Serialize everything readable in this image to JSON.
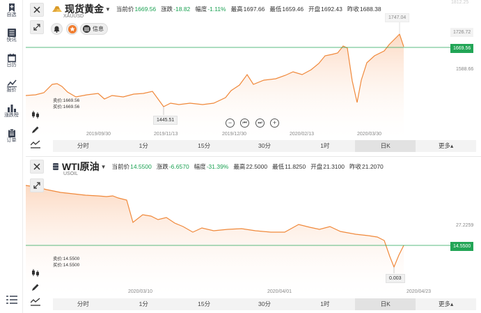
{
  "sidebar": {
    "items": [
      {
        "icon": "bookmark-plus-icon",
        "label": "自选"
      },
      {
        "icon": "news-list-icon",
        "label": "快讯"
      },
      {
        "icon": "calendar-icon",
        "label": "日历"
      },
      {
        "icon": "line-chart-icon",
        "label": "报价"
      },
      {
        "icon": "bar-chart-icon",
        "label": "涨跌榜"
      },
      {
        "icon": "clipboard-icon",
        "label": "订单"
      }
    ],
    "menu_icon": "menu-list-icon"
  },
  "panel1": {
    "title": "现货黄金",
    "symbol": "XAUUSD",
    "quotes": [
      {
        "label": "当前价",
        "value": "1669.56",
        "color": "#1aa152"
      },
      {
        "label": "涨跌",
        "value": "-18.82",
        "color": "#1aa152"
      },
      {
        "label": "幅度",
        "value": "-1.11%",
        "color": "#1aa152"
      },
      {
        "label": "最高",
        "value": "1697.66",
        "color": "#333333"
      },
      {
        "label": "最低",
        "value": "1659.46",
        "color": "#333333"
      },
      {
        "label": "开盘",
        "value": "1692.43",
        "color": "#333333"
      },
      {
        "label": "昨收",
        "value": "1688.38",
        "color": "#333333"
      }
    ],
    "info_label": "信息",
    "bid": "卖价:1669.56",
    "ask": "买价:1669.56",
    "current_price_tag": "1669.56",
    "y_labels": [
      "1726.72",
      "1588.66"
    ],
    "corner_faint": "1812.25",
    "high_annotation": "1747.04",
    "low_annotation": "1445.51",
    "dates": [
      "2019/09/30",
      "2019/11/13",
      "2019/12/30",
      "2020/02/13",
      "2020/03/30"
    ],
    "nav_buttons": [
      "−",
      "⏮",
      "⏭",
      "+"
    ]
  },
  "panel2": {
    "title": "WTI原油",
    "symbol": "USOIL",
    "quotes": [
      {
        "label": "当前价",
        "value": "14.5500",
        "color": "#1aa152"
      },
      {
        "label": "涨跌",
        "value": "-6.6570",
        "color": "#1aa152"
      },
      {
        "label": "幅度",
        "value": "-31.39%",
        "color": "#1aa152"
      },
      {
        "label": "最高",
        "value": "22.5000",
        "color": "#333333"
      },
      {
        "label": "最低",
        "value": "11.8250",
        "color": "#333333"
      },
      {
        "label": "开盘",
        "value": "21.3100",
        "color": "#333333"
      },
      {
        "label": "昨收",
        "value": "21.2070",
        "color": "#333333"
      }
    ],
    "bid": "卖价:14.5500",
    "ask": "买价:14.5500",
    "current_price_tag": "14.5500",
    "y_labels": [
      "27.2259"
    ],
    "low_annotation": "0.003",
    "dates": [
      "2020/03/10",
      "2020/04/01",
      "2020/04/23"
    ]
  },
  "timeframes": [
    "分时",
    "1分",
    "15分",
    "30分",
    "1时",
    "日K",
    "更多▴"
  ],
  "active_timeframe": "日K",
  "colors": {
    "line": "#f0893b",
    "fill": "#fde5d6",
    "price_line": "#22a556",
    "green": "#1aa152"
  }
}
